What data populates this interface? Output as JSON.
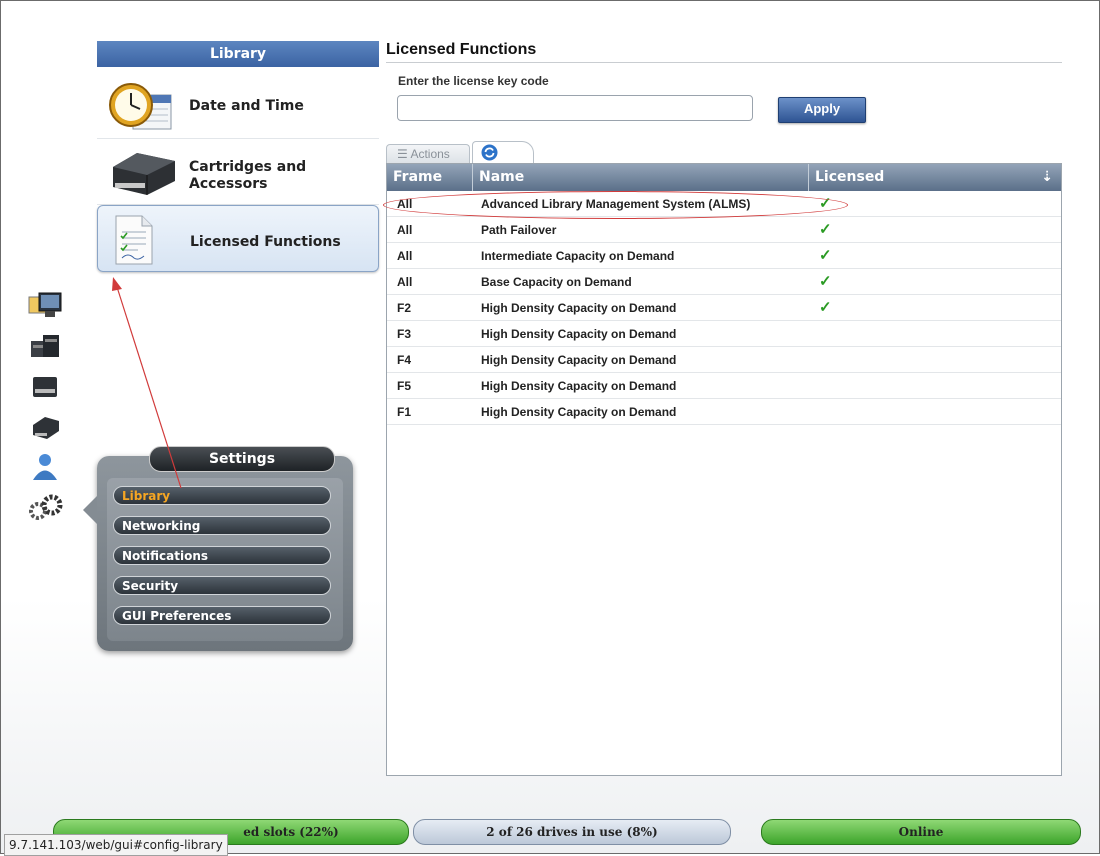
{
  "library_panel": {
    "header": "Library",
    "items": [
      {
        "label": "Date and Time",
        "icon": "clock-calendar-icon"
      },
      {
        "label_line1": "Cartridges and",
        "label_line2": "Accessors",
        "icon": "cartridge-drive-icon"
      },
      {
        "label": "Licensed Functions",
        "icon": "license-document-icon",
        "selected": true
      }
    ]
  },
  "left_rail": {
    "icons": [
      "monitoring-icon",
      "library-icon",
      "drive-icon",
      "cartridge-icon",
      "user-icon",
      "settings-gears-icon"
    ]
  },
  "settings_menu": {
    "title": "Settings",
    "items": [
      "Library",
      "Networking",
      "Notifications",
      "Security",
      "GUI Preferences"
    ],
    "active_item": "Library"
  },
  "licensed_functions": {
    "title": "Licensed Functions",
    "key_label": "Enter the license key code",
    "key_value": "",
    "apply_label": "Apply",
    "tabs": {
      "actions_label": "Actions",
      "refresh_icon": "refresh-icon"
    },
    "columns": [
      "Frame",
      "Name",
      "Licensed"
    ],
    "rows": [
      {
        "frame": "All",
        "name": "Advanced Library Management System (ALMS)",
        "licensed": "✓"
      },
      {
        "frame": "All",
        "name": "Path Failover",
        "licensed": "✓"
      },
      {
        "frame": "All",
        "name": "Intermediate Capacity on Demand",
        "licensed": "✓"
      },
      {
        "frame": "All",
        "name": "Base Capacity on Demand",
        "licensed": "✓"
      },
      {
        "frame": "F2",
        "name": "High Density Capacity on Demand",
        "licensed": "✓"
      },
      {
        "frame": "F3",
        "name": "High Density Capacity on Demand",
        "licensed": ""
      },
      {
        "frame": "F4",
        "name": "High Density Capacity on Demand",
        "licensed": ""
      },
      {
        "frame": "F5",
        "name": "High Density Capacity on Demand",
        "licensed": ""
      },
      {
        "frame": "F1",
        "name": "High Density Capacity on Demand",
        "licensed": ""
      }
    ]
  },
  "status_bar": {
    "slots": "ed slots (22%)",
    "drives": "2 of 26 drives in use (8%)",
    "state": "Online",
    "url": "9.7.141.103/web/gui#config-library"
  },
  "colors": {
    "accent": "#3b63a3",
    "licensed_check": "#2b9b24",
    "annotation": "#d13b3b",
    "status_green": "#3da52b"
  }
}
